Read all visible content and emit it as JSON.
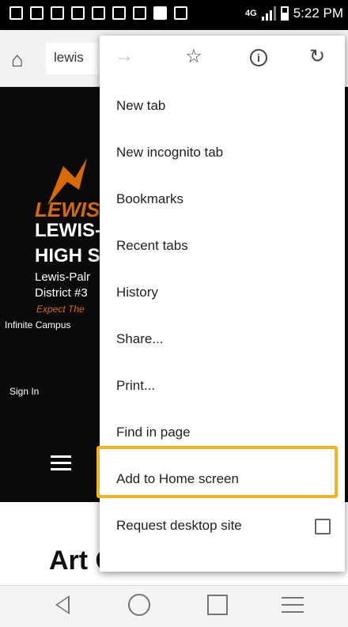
{
  "status_bar": {
    "network": "4G",
    "time": "5:22 PM"
  },
  "browser": {
    "url_text": "lewis"
  },
  "website": {
    "logo_text": "LEWIS-P",
    "title_line1": "LEWIS-",
    "title_line2": "HIGH S",
    "subtitle_line1": "Lewis-Palr",
    "subtitle_line2": "District #3",
    "tagline": "Expect The",
    "campus_link": "Infinite Campus",
    "sign_in": "Sign In",
    "heading": "Art Club"
  },
  "menu": {
    "icons": [
      "forward-icon",
      "star-icon",
      "info-icon",
      "refresh-icon"
    ],
    "items": [
      {
        "label": "New tab"
      },
      {
        "label": "New incognito tab"
      },
      {
        "label": "Bookmarks"
      },
      {
        "label": "Recent tabs"
      },
      {
        "label": "History"
      },
      {
        "label": "Share..."
      },
      {
        "label": "Print..."
      },
      {
        "label": "Find in page"
      },
      {
        "label": "Add to Home screen"
      },
      {
        "label": "Request desktop site"
      }
    ],
    "highlight_color": "#f0b323"
  },
  "colors": {
    "accent_orange": "#d96a00"
  }
}
